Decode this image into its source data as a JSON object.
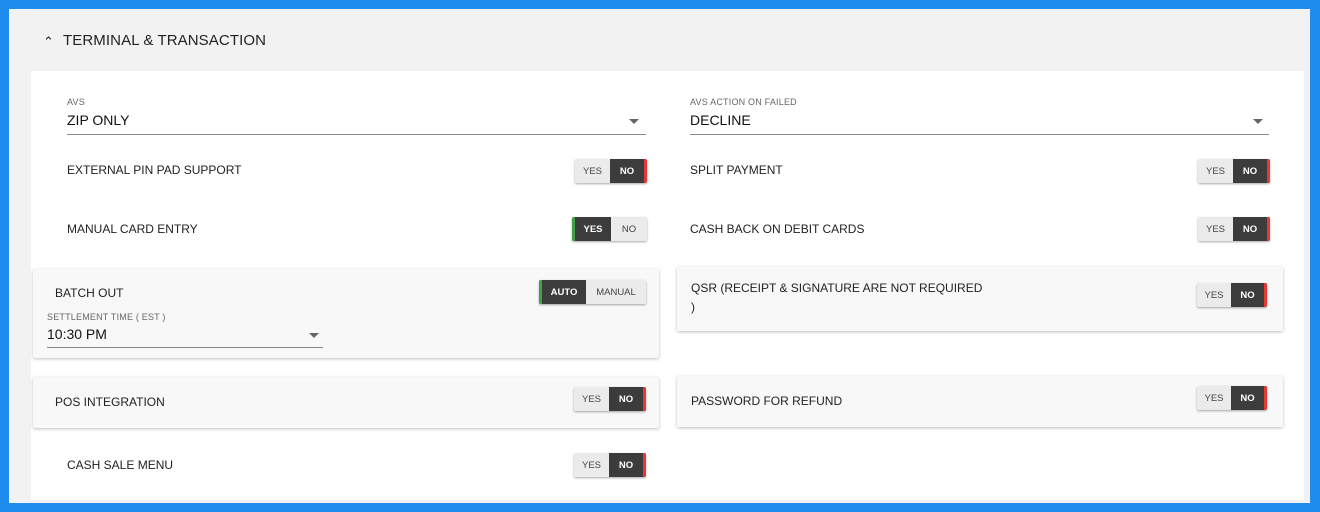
{
  "section": {
    "title": "TERMINAL & TRANSACTION",
    "icon": "chevron-up-icon"
  },
  "avs": {
    "label": "AVS",
    "value": "ZIP ONLY"
  },
  "avs_action": {
    "label": "AVS ACTION ON FAILED",
    "value": "DECLINE"
  },
  "rows": {
    "external_pin_pad": {
      "label": "EXTERNAL PIN PAD SUPPORT",
      "yes": "YES",
      "no": "NO",
      "selected": "NO"
    },
    "split_payment": {
      "label": "SPLIT PAYMENT",
      "yes": "YES",
      "no": "NO",
      "selected": "NO"
    },
    "manual_card_entry": {
      "label": "MANUAL CARD ENTRY",
      "yes": "YES",
      "no": "NO",
      "selected": "YES"
    },
    "cash_back": {
      "label": "CASH BACK ON DEBIT CARDS",
      "yes": "YES",
      "no": "NO",
      "selected": "NO"
    },
    "qsr": {
      "label": "QSR (RECEIPT & SIGNATURE ARE NOT REQUIRED",
      "label_end": ")",
      "yes": "YES",
      "no": "NO",
      "selected": "NO"
    },
    "pos_integration": {
      "label": "POS INTEGRATION",
      "yes": "YES",
      "no": "NO",
      "selected": "NO"
    },
    "password_refund": {
      "label": "PASSWORD FOR REFUND",
      "yes": "YES",
      "no": "NO",
      "selected": "NO"
    },
    "cash_sale_menu": {
      "label": "CASH SALE MENU",
      "yes": "YES",
      "no": "NO",
      "selected": "NO"
    }
  },
  "batch_out": {
    "label": "BATCH OUT",
    "auto": "AUTO",
    "manual": "MANUAL",
    "selected": "AUTO",
    "settlement_label": "SETTLEMENT TIME ( EST )",
    "settlement_value": "10:30 PM"
  },
  "colors": {
    "accent_blue": "#1e8ded",
    "on": "#3c3c3c",
    "no_marker": "#e53935",
    "yes_marker": "#43a047"
  }
}
